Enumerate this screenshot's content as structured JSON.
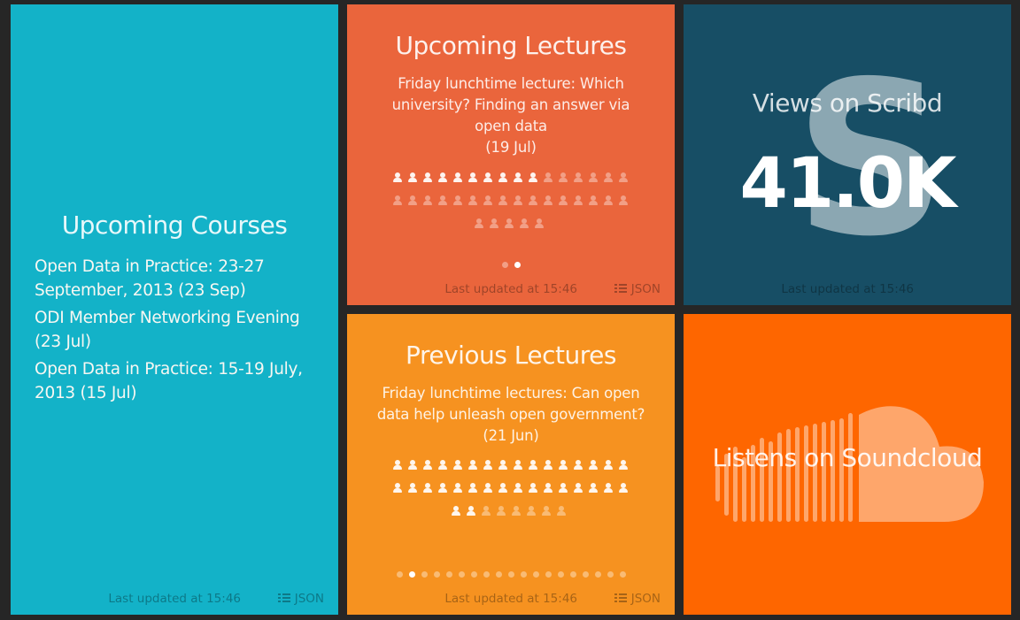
{
  "colors": {
    "background": "#262626",
    "courses": "#13b2c8",
    "upcoming_lectures": "#ea653c",
    "scribd": "#174e65",
    "previous_lectures": "#f69220",
    "soundcloud": "#fe6600"
  },
  "courses": {
    "title": "Upcoming Courses",
    "items": [
      "Open Data in Practice: 23-27 September, 2013 (23 Sep)",
      "ODI Member Networking Evening (23 Jul)",
      "Open Data in Practice: 15-19 July, 2013 (15 Jul)"
    ],
    "updated": "Last updated at 15:46",
    "json_label": "JSON"
  },
  "upcoming_lectures": {
    "title": "Upcoming Lectures",
    "lecture_name": "Friday lunchtime lecture: Which university? Finding an answer via open data",
    "date": "(19 Jul)",
    "attendees_registered": 10,
    "attendees_total": 37,
    "pages": 2,
    "active_page": 2,
    "updated": "Last updated at 15:46",
    "json_label": "JSON"
  },
  "scribd": {
    "logo_letter": "S",
    "title": "Views on Scribd",
    "value": "41.0K",
    "updated": "Last updated at 15:46"
  },
  "previous_lectures": {
    "title": "Previous Lectures",
    "lecture_name": "Friday lunchtime lectures: Can open data help unleash open government?",
    "date": "(21 Jun)",
    "attendees_registered": 34,
    "attendees_total": 40,
    "pages": 19,
    "active_page": 2,
    "updated": "Last updated at 15:46",
    "json_label": "JSON"
  },
  "soundcloud": {
    "icon": "soundcloud-icon",
    "title": "Listens on Soundcloud"
  }
}
